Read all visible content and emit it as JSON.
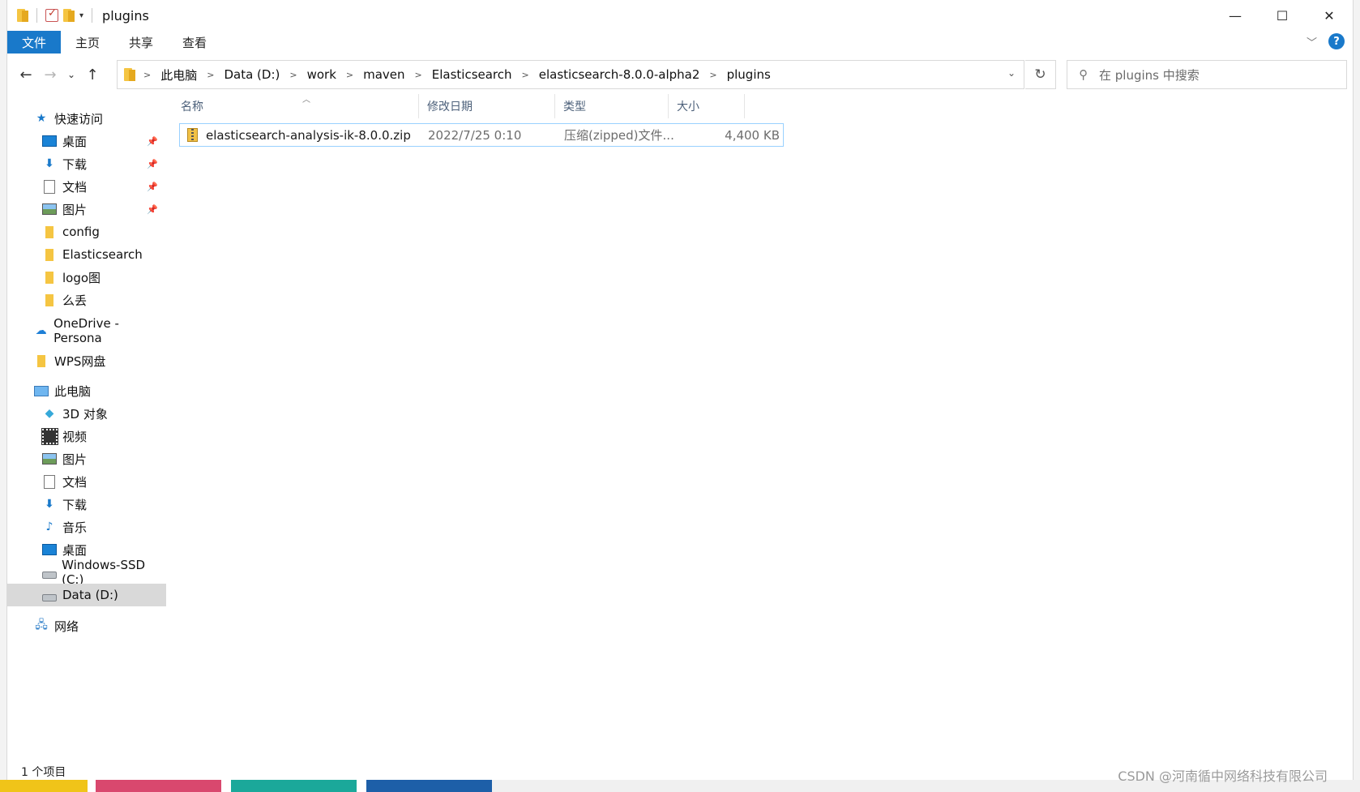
{
  "window": {
    "title": "plugins",
    "controls": {
      "minimize": "—",
      "maximize": "☐",
      "close": "✕"
    }
  },
  "ribbon": {
    "tabs": [
      "文件",
      "主页",
      "共享",
      "查看"
    ],
    "help": "?"
  },
  "address": {
    "crumbs": [
      "此电脑",
      "Data (D:)",
      "work",
      "maven",
      "Elasticsearch",
      "elasticsearch-8.0.0-alpha2",
      "plugins"
    ],
    "search_placeholder": "在 plugins 中搜索"
  },
  "navpane": {
    "quick_access": "快速访问",
    "quick_items": [
      {
        "label": "桌面",
        "icon": "desktop-icon",
        "pinned": true
      },
      {
        "label": "下载",
        "icon": "download-icon",
        "pinned": true
      },
      {
        "label": "文档",
        "icon": "document-icon",
        "pinned": true
      },
      {
        "label": "图片",
        "icon": "pictures-icon",
        "pinned": true
      },
      {
        "label": "config",
        "icon": "folder-icon",
        "pinned": false
      },
      {
        "label": "Elasticsearch",
        "icon": "folder-icon",
        "pinned": false
      },
      {
        "label": "logo图",
        "icon": "folder-icon",
        "pinned": false
      },
      {
        "label": "么丢",
        "icon": "folder-icon",
        "pinned": false
      }
    ],
    "onedrive": "OneDrive - Persona",
    "wps": "WPS网盘",
    "this_pc": "此电脑",
    "pc_items": [
      {
        "label": "3D 对象",
        "icon": "3d-objects-icon"
      },
      {
        "label": "视频",
        "icon": "video-icon"
      },
      {
        "label": "图片",
        "icon": "pictures-icon"
      },
      {
        "label": "文档",
        "icon": "document-icon"
      },
      {
        "label": "下载",
        "icon": "download-icon"
      },
      {
        "label": "音乐",
        "icon": "music-icon"
      },
      {
        "label": "桌面",
        "icon": "desktop-icon"
      },
      {
        "label": "Windows-SSD (C:)",
        "icon": "windows-drive-icon"
      },
      {
        "label": "Data (D:)",
        "icon": "drive-icon",
        "selected": true
      }
    ],
    "network": "网络"
  },
  "columns": {
    "name": "名称",
    "modified": "修改日期",
    "type": "类型",
    "size": "大小"
  },
  "files": [
    {
      "name": "elasticsearch-analysis-ik-8.0.0.zip",
      "modified": "2022/7/25 0:10",
      "type": "压缩(zipped)文件...",
      "size": "4,400 KB"
    }
  ],
  "status": {
    "count": "1 个项目"
  },
  "watermark": "CSDN @河南循中网络科技有限公司"
}
